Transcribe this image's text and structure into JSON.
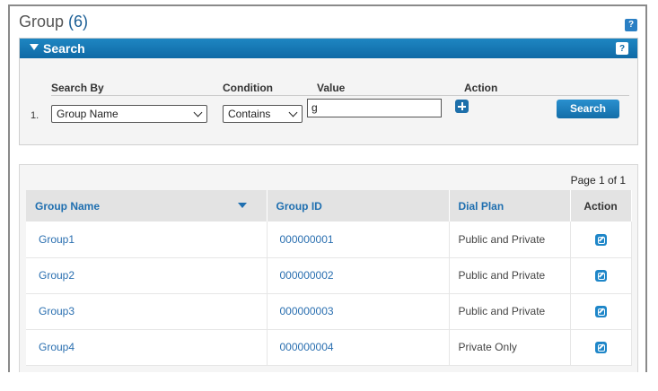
{
  "page": {
    "title": "Group",
    "count": "(6)"
  },
  "help": {
    "label": "?"
  },
  "search": {
    "title": "Search",
    "headers": {
      "search_by": "Search By",
      "condition": "Condition",
      "value": "Value",
      "action": "Action"
    },
    "row_number": "1.",
    "search_by": "Group Name",
    "condition": "Contains",
    "value": "g",
    "button": "Search"
  },
  "results": {
    "pager": "Page 1 of 1",
    "columns": [
      "Group Name",
      "Group ID",
      "Dial Plan",
      "Action"
    ],
    "rows": [
      {
        "name": "Group1",
        "id": "000000001",
        "plan": "Public and Private"
      },
      {
        "name": "Group2",
        "id": "000000002",
        "plan": "Public and Private"
      },
      {
        "name": "Group3",
        "id": "000000003",
        "plan": "Public and Private"
      },
      {
        "name": "Group4",
        "id": "000000004",
        "plan": "Private Only"
      }
    ]
  },
  "icons": {
    "help": "question-mark-icon",
    "add": "plus-icon",
    "edit": "edit-icon",
    "sort": "caret-down-icon"
  }
}
